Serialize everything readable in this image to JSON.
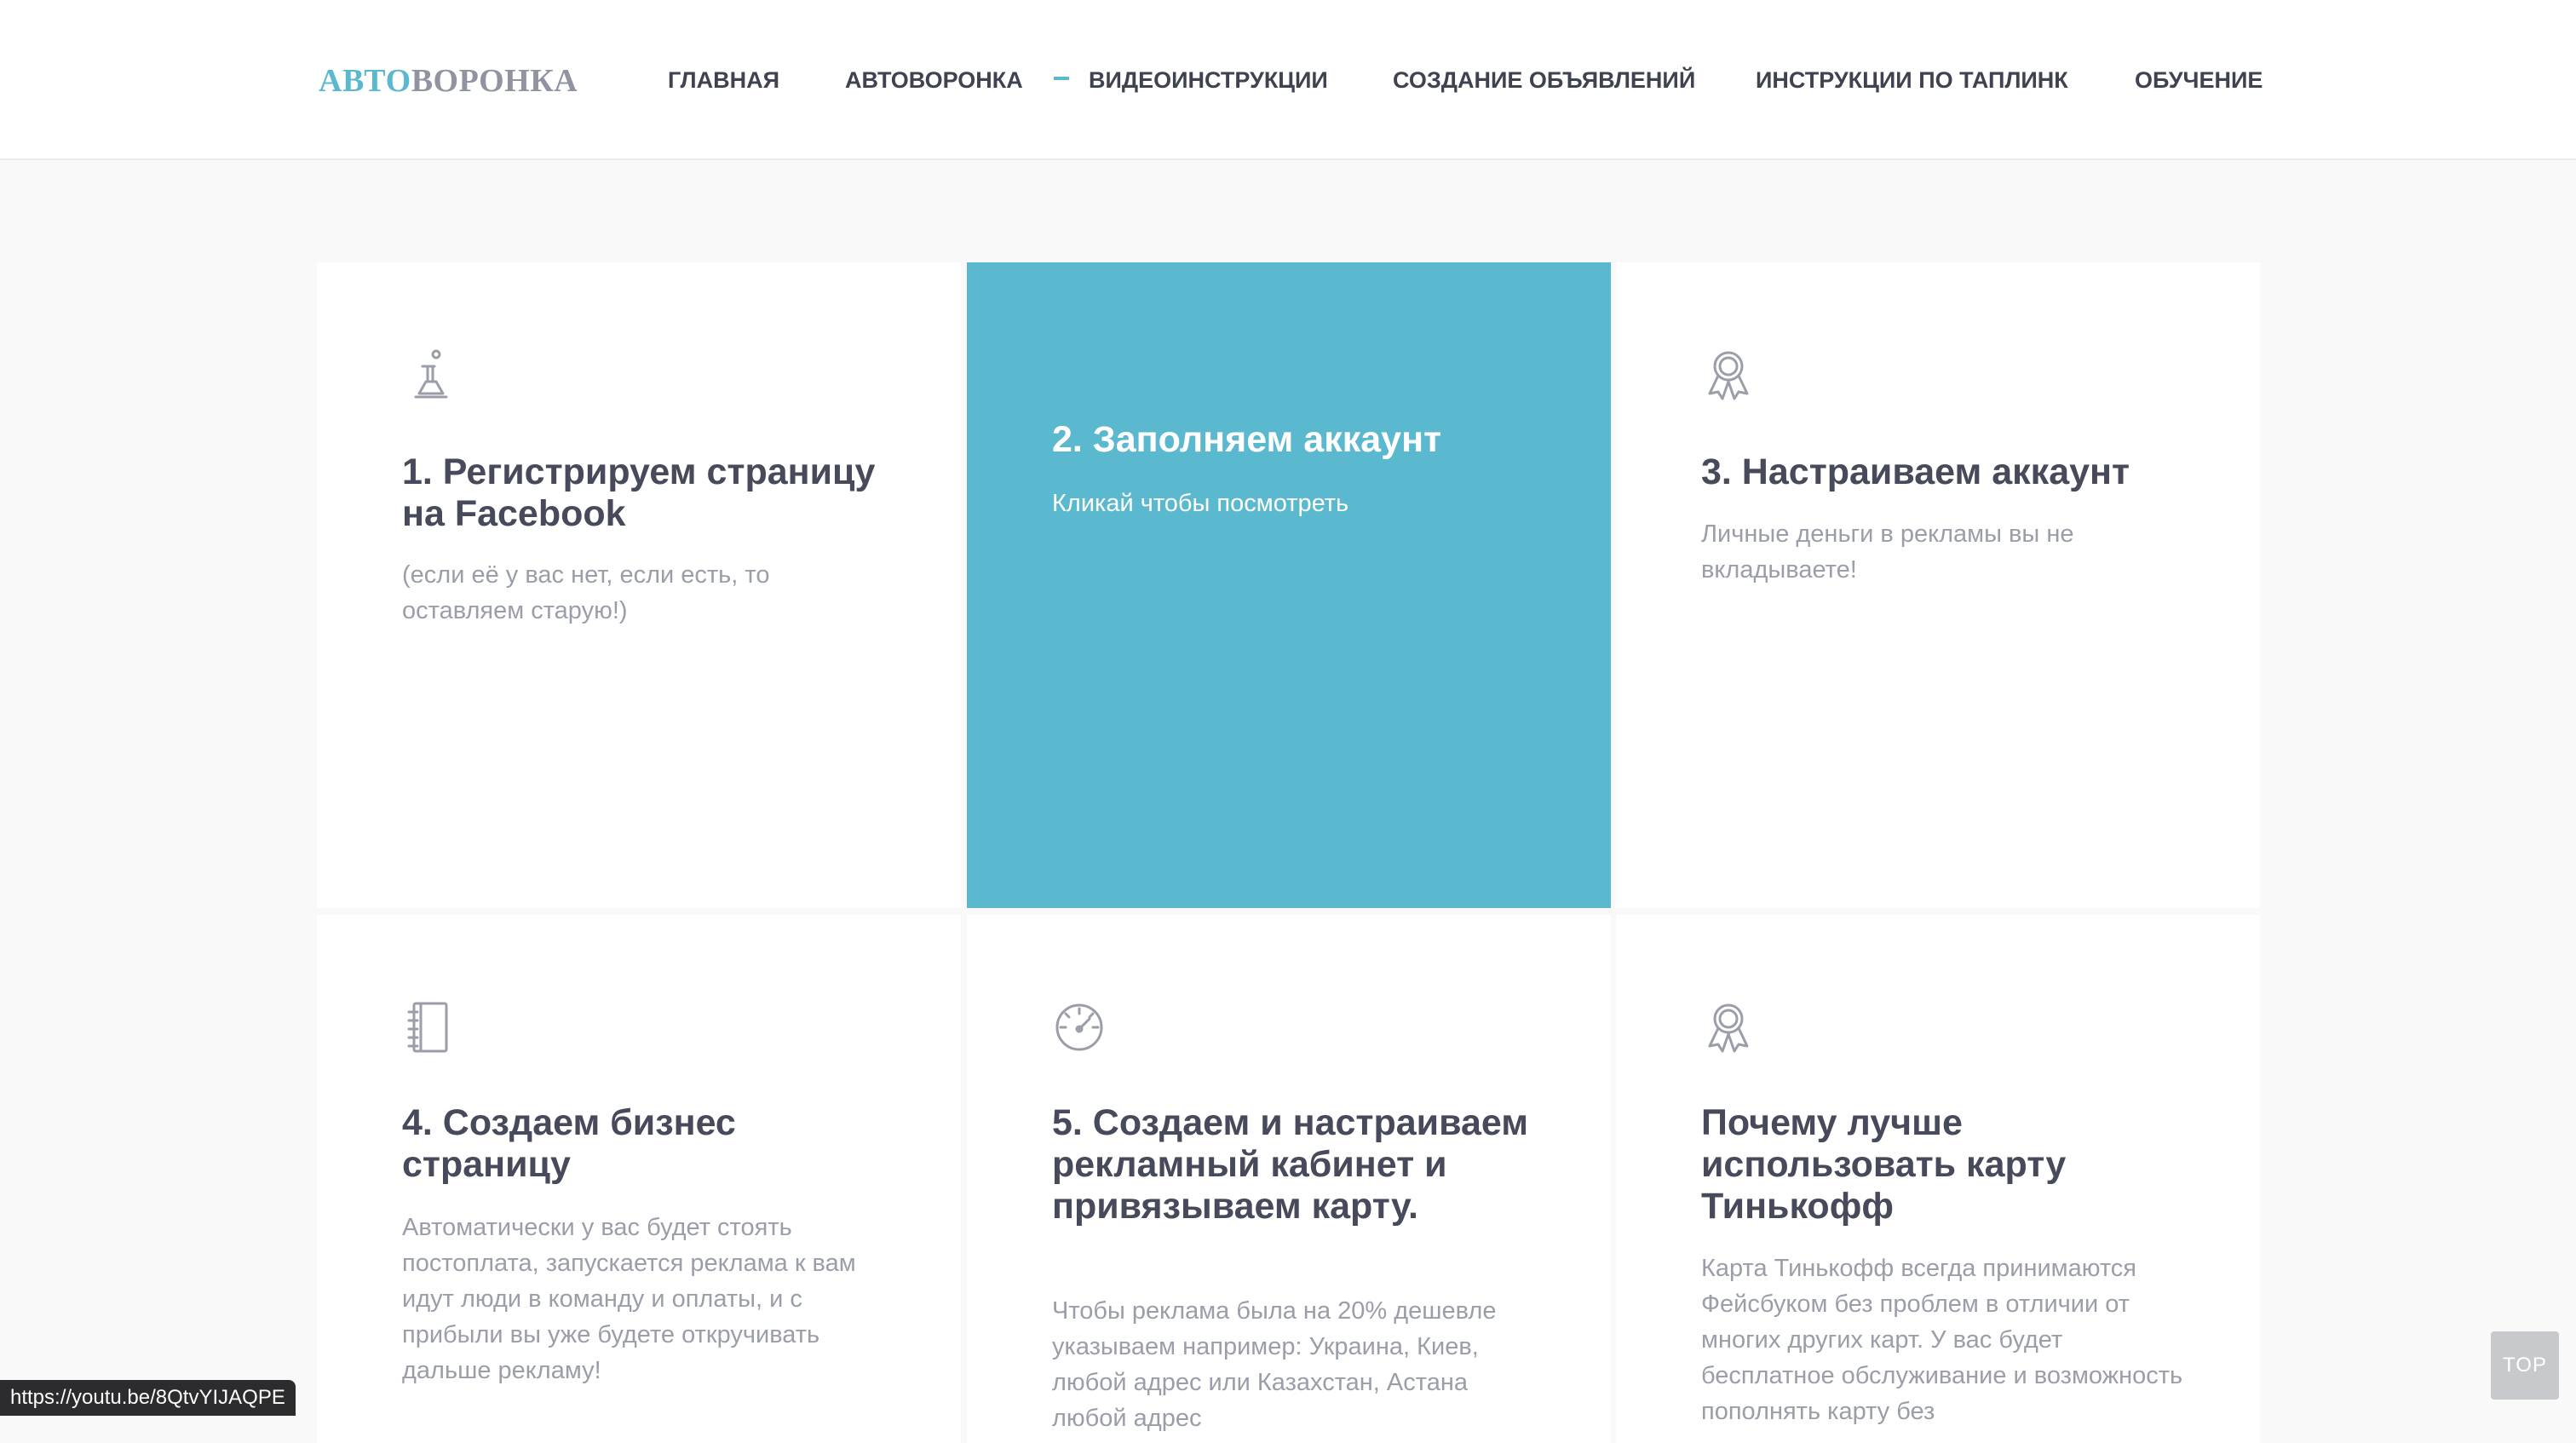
{
  "header": {
    "logo_part1": "АВТО",
    "logo_part2": "ВОРОНКА",
    "nav": [
      {
        "label": "ГЛАВНАЯ"
      },
      {
        "label": "АВТОВОРОНКА"
      },
      {
        "label": "ВИДЕОИНСТРУКЦИИ"
      },
      {
        "label": "СОЗДАНИЕ ОБЪЯВЛЕНИЙ"
      },
      {
        "label": "ИНСТРУКЦИИ ПО ТАПЛИНК"
      },
      {
        "label": "ОБУЧЕНИЕ"
      }
    ]
  },
  "cards": [
    {
      "icon": "chess-pawn-icon",
      "title": "1. Регистрируем страницу на Facebook",
      "desc": "(если её у вас нет, если есть, то оставляем старую!)"
    },
    {
      "icon": "none",
      "title": "2. Заполняем аккаунт",
      "desc": "Кликай чтобы посмотреть"
    },
    {
      "icon": "award-ribbon-icon",
      "title": "3. Настраиваем аккаунт",
      "desc": "Личные деньги в рекламы вы не вкладываете!"
    },
    {
      "icon": "notebook-icon",
      "title": "4. Создаем бизнес страницу",
      "desc": "Автоматически у вас будет стоять постоплата, запускается реклама к вам идут люди в команду и оплаты, и с прибыли вы уже будете откручивать дальше рекламу!"
    },
    {
      "icon": "speedometer-icon",
      "title": "5. Создаем и настраиваем рекламный кабинет и привязываем карту.",
      "desc": "Чтобы реклама была на 20% дешевле указываем например: Украина, Киев, любой адрес или Казахстан, Астана любой адрес"
    },
    {
      "icon": "award-ribbon-icon",
      "title": "Почему лучше использовать карту Тинькофф",
      "desc": "Карта Тинькофф всегда принимаются Фейсбуком без проблем в отличии от многих других карт. У вас будет бесплатное обслуживание и возможность пополнять карту без"
    }
  ],
  "status_url": "https://youtu.be/8QtvYIJAQPE",
  "top_button": "TOP",
  "colors": {
    "accent": "#5bb9cf",
    "text": "#464a5a",
    "muted": "#9a9ea8"
  }
}
